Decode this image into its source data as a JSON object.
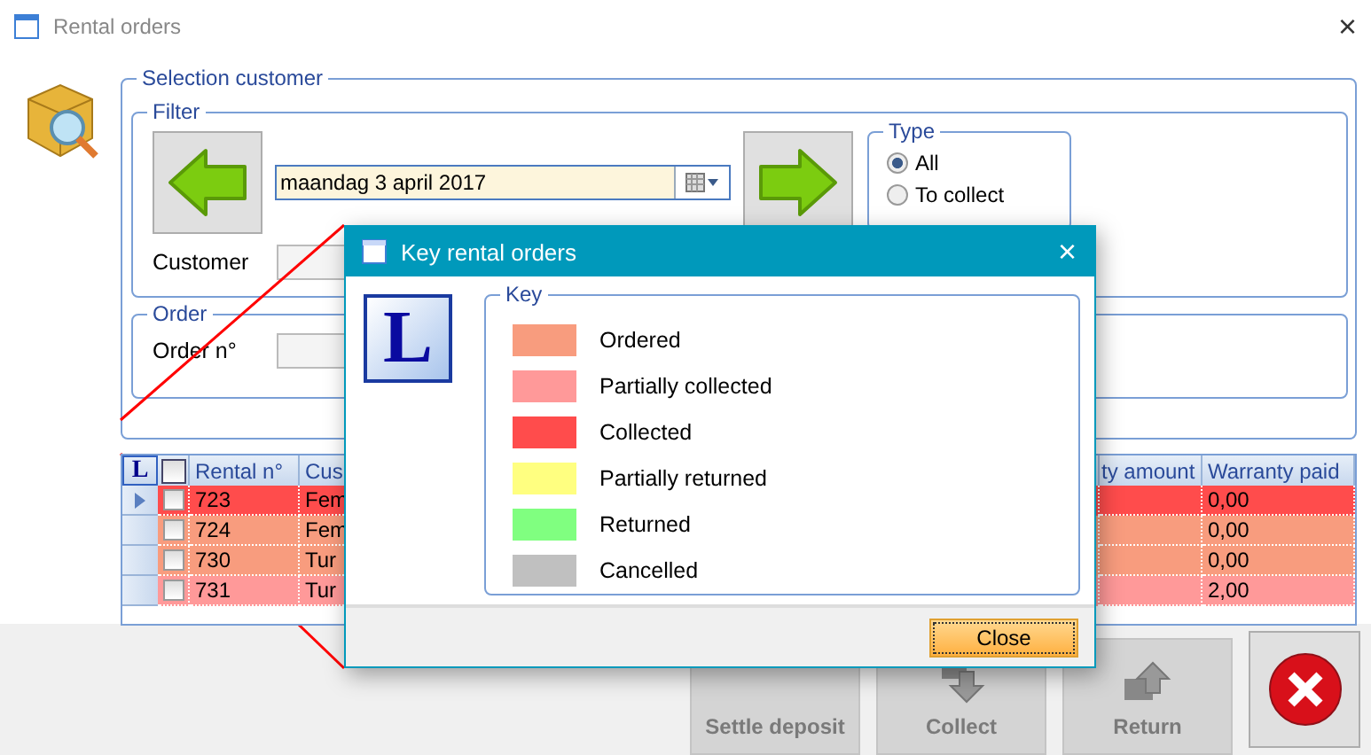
{
  "window": {
    "title": "Rental orders",
    "close": "×"
  },
  "selection_customer": {
    "label": "Selection customer",
    "filter": {
      "label": "Filter",
      "date": "maandag 3 april 2017",
      "customer_label": "Customer",
      "type": {
        "label": "Type",
        "options": [
          {
            "label": "All",
            "selected": true
          },
          {
            "label": "To collect",
            "selected": false
          }
        ]
      }
    },
    "order": {
      "label": "Order",
      "order_label": "Order n°"
    }
  },
  "grid": {
    "legend_button": "L",
    "header_checked": false,
    "columns": [
      "Rental n°",
      "Cus",
      "ty amount",
      "Warranty paid"
    ],
    "rows": [
      {
        "current": true,
        "checked": false,
        "color": "#ff4c4c",
        "cells": [
          "723",
          "Fem",
          "",
          "0,00"
        ]
      },
      {
        "current": false,
        "checked": false,
        "color": "#f89c7e",
        "cells": [
          "724",
          "Fem",
          "",
          "0,00"
        ]
      },
      {
        "current": false,
        "checked": false,
        "color": "#f89c7e",
        "cells": [
          "730",
          "Tur",
          "",
          "0,00"
        ]
      },
      {
        "current": false,
        "checked": false,
        "color": "#ff9999",
        "cells": [
          "731",
          "Tur",
          "",
          "2,00"
        ]
      }
    ]
  },
  "buttons": [
    {
      "kind": "plain",
      "label": "Settle deposit",
      "disabled": true
    },
    {
      "kind": "collect",
      "label": "Collect",
      "disabled": true
    },
    {
      "kind": "return",
      "label": "Return",
      "disabled": true
    },
    {
      "kind": "exit"
    }
  ],
  "dialog": {
    "title": "Key rental orders",
    "close": "×",
    "logo": "L",
    "key_label": "Key",
    "legend": [
      {
        "label": "Ordered",
        "color": "#f89c7e"
      },
      {
        "label": "Partially collected",
        "color": "#ff9999"
      },
      {
        "label": "Collected",
        "color": "#ff4c4c"
      },
      {
        "label": "Partially returned",
        "color": "#ffff80"
      },
      {
        "label": "Returned",
        "color": "#80ff80"
      },
      {
        "label": "Cancelled",
        "color": "#c0c0c0"
      }
    ],
    "button": "Close"
  }
}
